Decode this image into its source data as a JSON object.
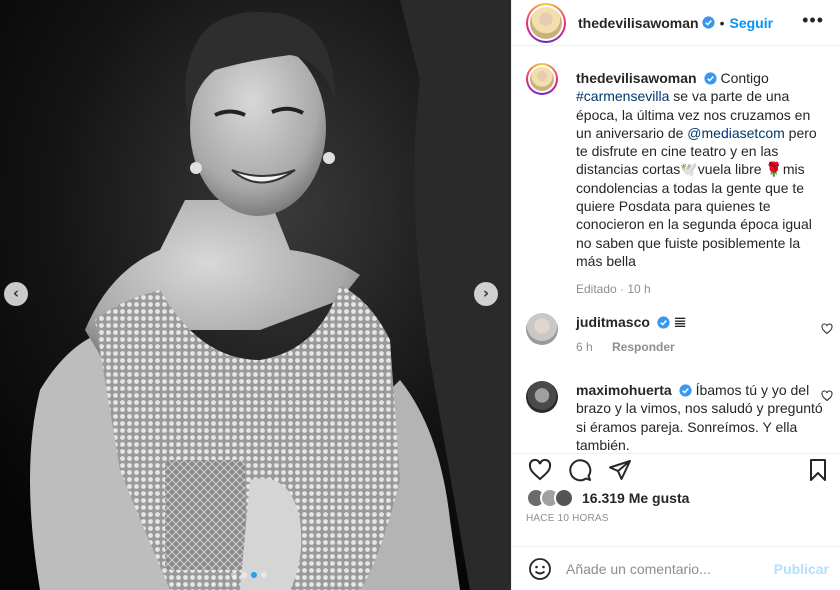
{
  "carousel": {
    "prev_icon": "chevron-left-icon",
    "next_icon": "chevron-right-icon",
    "dots_total": 4,
    "active_index": 2
  },
  "post_header": {
    "username": "thedevilisawoman",
    "separator": "•",
    "follow_label": "Seguir",
    "more_label": "•••"
  },
  "caption": {
    "username": "thedevilisawoman",
    "parts": {
      "t1": "Contigo",
      "tag1": "#carmensevilla",
      "t2": " se va parte de una época, la última vez nos cruzamos en un aniversario de ",
      "tag2": "@mediasetcom",
      "t3": " pero te disfrute en cine teatro y en las distancias cortas🕊️vuela libre 🌹mis condolencias a todas la gente que te quiere Posdata para quienes te conocieron en la segunda época igual no saben que fuiste posiblemente la más bella"
    },
    "meta": "Editado · 10 h"
  },
  "comments": [
    {
      "username": "juditmasco",
      "text": "𝌆",
      "time": "6 h",
      "reply_label": "Responder"
    },
    {
      "username": "maximohuerta",
      "text": "Íbamos tú y yo del brazo y la vimos, nos saludó y preguntó si éramos pareja. Sonreímos. Y ella también."
    }
  ],
  "actions": {
    "likes": "16.319 Me gusta",
    "timestamp": "HACE 10 HORAS"
  },
  "composer": {
    "placeholder": "Añade un comentario...",
    "publish_label": "Publicar"
  },
  "colors": {
    "link": "#00376b",
    "follow": "#0095f6",
    "publish_disabled": "#b2dffc",
    "verified": "#3897f0",
    "active_dot": "#1da1f2"
  }
}
